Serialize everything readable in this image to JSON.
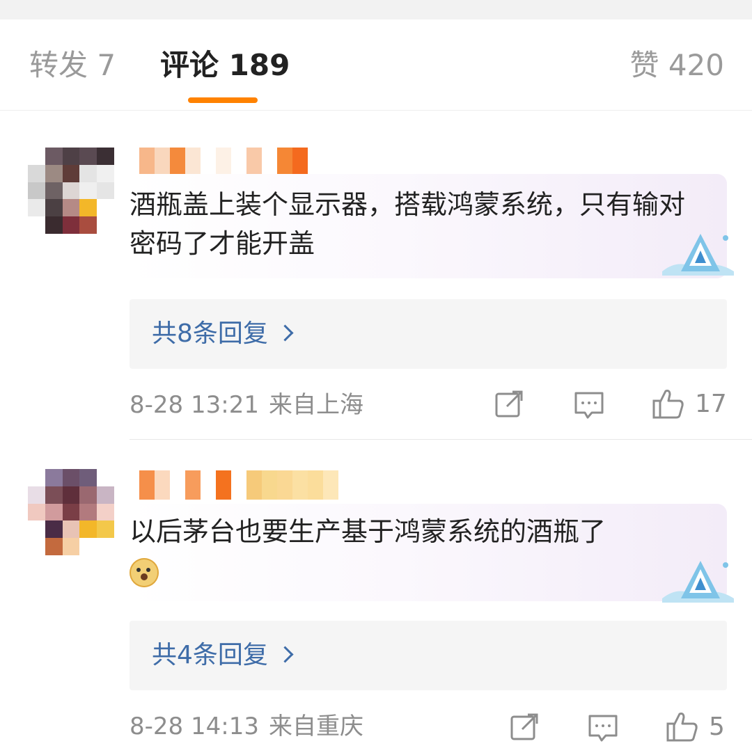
{
  "tabs": {
    "repost": "转发 7",
    "comments": "评论 189",
    "likes": "赞 420",
    "accent_color": "#ff8200"
  },
  "comments": [
    {
      "text": "酒瓶盖上装个显示器，搭载鸿蒙系统，只有输对密码了才能开盖",
      "replies_label": "共8条回复",
      "time": "8-28 13:21",
      "location": "来自上海",
      "likes": "17",
      "icons": [
        "repost-icon",
        "comment-icon",
        "thumbs-up-icon"
      ]
    },
    {
      "text": "以后茅台也要生产基于鸿蒙系统的酒瓶了",
      "emoji": "doge-emoji",
      "replies_label": "共4条回复",
      "time": "8-28 14:13",
      "location": "来自重庆",
      "likes": "5",
      "icons": [
        "repost-icon",
        "comment-icon",
        "thumbs-up-icon"
      ]
    }
  ],
  "colors": {
    "link": "#3e6ca8",
    "meta": "#8d8d8d",
    "text": "#222222"
  }
}
